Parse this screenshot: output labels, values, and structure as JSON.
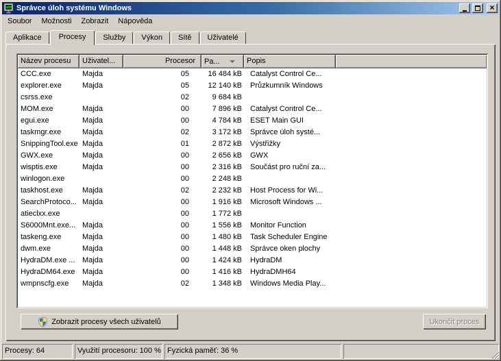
{
  "window": {
    "title": "Správce úloh systému Windows",
    "controls": {
      "close_glyph": "×"
    }
  },
  "menu": {
    "items": [
      {
        "label": "Soubor"
      },
      {
        "label": "Možnosti"
      },
      {
        "label": "Zobrazit"
      },
      {
        "label": "Nápověda"
      }
    ]
  },
  "tabs": [
    {
      "label": "Aplikace",
      "active": false
    },
    {
      "label": "Procesy",
      "active": true
    },
    {
      "label": "Služby",
      "active": false
    },
    {
      "label": "Výkon",
      "active": false
    },
    {
      "label": "Sítě",
      "active": false
    },
    {
      "label": "Uživatelé",
      "active": false
    }
  ],
  "process_table": {
    "columns": {
      "name": "Název procesu",
      "user": "Uživatel...",
      "cpu": "Procesor",
      "memory": "Pa...",
      "description": "Popis"
    },
    "sort": {
      "column": "memory",
      "direction": "desc"
    },
    "rows": [
      {
        "name": "CCC.exe",
        "user": "Majda",
        "cpu": "05",
        "memory": "16 484 kB",
        "description": "Catalyst Control Ce..."
      },
      {
        "name": "explorer.exe",
        "user": "Majda",
        "cpu": "05",
        "memory": "12 140 kB",
        "description": "Průzkumník Windows"
      },
      {
        "name": "csrss.exe",
        "user": "",
        "cpu": "02",
        "memory": "9 684 kB",
        "description": ""
      },
      {
        "name": "MOM.exe",
        "user": "Majda",
        "cpu": "00",
        "memory": "7 896 kB",
        "description": "Catalyst Control Ce..."
      },
      {
        "name": "egui.exe",
        "user": "Majda",
        "cpu": "00",
        "memory": "4 784 kB",
        "description": "ESET Main GUI"
      },
      {
        "name": "taskmgr.exe",
        "user": "Majda",
        "cpu": "02",
        "memory": "3 172 kB",
        "description": "Správce úloh systé..."
      },
      {
        "name": "SnippingTool.exe",
        "user": "Majda",
        "cpu": "01",
        "memory": "2 872 kB",
        "description": "Výstřižky"
      },
      {
        "name": "GWX.exe",
        "user": "Majda",
        "cpu": "00",
        "memory": "2 656 kB",
        "description": "GWX"
      },
      {
        "name": "wisptis.exe",
        "user": "Majda",
        "cpu": "00",
        "memory": "2 316 kB",
        "description": "Součást pro ruční za..."
      },
      {
        "name": "winlogon.exe",
        "user": "",
        "cpu": "00",
        "memory": "2 248 kB",
        "description": ""
      },
      {
        "name": "taskhost.exe",
        "user": "Majda",
        "cpu": "02",
        "memory": "2 232 kB",
        "description": "Host Process for Wi..."
      },
      {
        "name": "SearchProtoco...",
        "user": "Majda",
        "cpu": "00",
        "memory": "1 916 kB",
        "description": "Microsoft Windows ..."
      },
      {
        "name": "atieclxx.exe",
        "user": "",
        "cpu": "00",
        "memory": "1 772 kB",
        "description": ""
      },
      {
        "name": "S6000Mnt.exe...",
        "user": "Majda",
        "cpu": "00",
        "memory": "1 556 kB",
        "description": "Monitor Function"
      },
      {
        "name": "taskeng.exe",
        "user": "Majda",
        "cpu": "00",
        "memory": "1 480 kB",
        "description": "Task Scheduler Engine"
      },
      {
        "name": "dwm.exe",
        "user": "Majda",
        "cpu": "00",
        "memory": "1 448 kB",
        "description": "Správce oken plochy"
      },
      {
        "name": "HydraDM.exe ...",
        "user": "Majda",
        "cpu": "00",
        "memory": "1 424 kB",
        "description": "HydraDM"
      },
      {
        "name": "HydraDM64.exe",
        "user": "Majda",
        "cpu": "00",
        "memory": "1 416 kB",
        "description": "HydraDMH64"
      },
      {
        "name": "wmpnscfg.exe",
        "user": "Majda",
        "cpu": "02",
        "memory": "1 348 kB",
        "description": "Windows Media Play..."
      }
    ]
  },
  "buttons": {
    "show_all_processes": "Zobrazit procesy všech uživatelů",
    "end_process": "Ukončit proces",
    "end_process_enabled": false
  },
  "status_bar": {
    "processes": "Procesy: 64",
    "cpu_usage": "Využití procesoru: 100 %",
    "physical_memory": "Fyzická paměť: 36 %"
  },
  "colors": {
    "titlebar_start": "#0a246a",
    "titlebar_end": "#a6caf0",
    "chrome": "#d4d0c8",
    "list_background": "#ffffff",
    "disabled_text": "#808080",
    "shield_blue": "#3a6fb5",
    "shield_yellow": "#fcd94c",
    "graph_green": "#00e000"
  }
}
